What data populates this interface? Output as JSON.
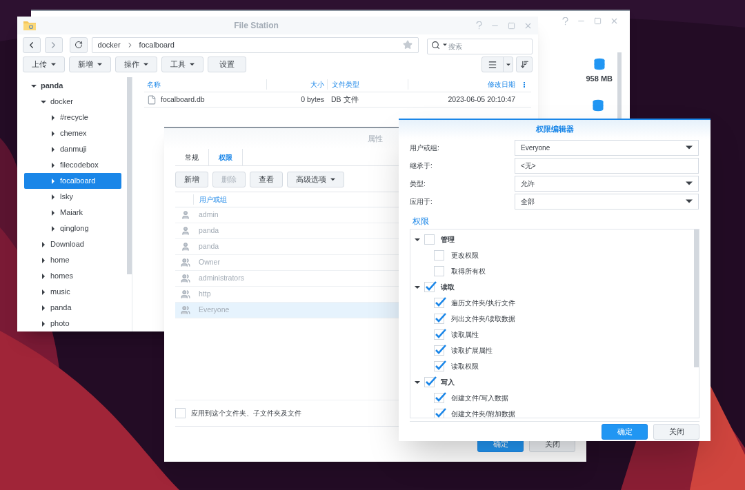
{
  "back_window": {
    "sizes": [
      "958 MB"
    ]
  },
  "file_station": {
    "title": "File Station",
    "path": [
      "docker",
      "focalboard"
    ],
    "search": {
      "placeholder": "搜索"
    },
    "toolbar": [
      {
        "label": "上传",
        "dropdown": true
      },
      {
        "label": "新增",
        "dropdown": true
      },
      {
        "label": "操作",
        "dropdown": true
      },
      {
        "label": "工具",
        "dropdown": true
      },
      {
        "label": "设置",
        "dropdown": false
      }
    ],
    "tree": [
      {
        "label": "panda",
        "expanded": true,
        "selected": false,
        "children": [
          {
            "label": "docker",
            "expanded": true,
            "selected": false,
            "children": [
              {
                "label": "#recycle",
                "expanded": false,
                "selected": false
              },
              {
                "label": "chemex",
                "expanded": false,
                "selected": false
              },
              {
                "label": "danmuji",
                "expanded": false,
                "selected": false
              },
              {
                "label": "filecodebox",
                "expanded": false,
                "selected": false
              },
              {
                "label": "focalboard",
                "expanded": false,
                "selected": true
              },
              {
                "label": "lsky",
                "expanded": false,
                "selected": false
              },
              {
                "label": "Maiark",
                "expanded": false,
                "selected": false
              },
              {
                "label": "qinglong",
                "expanded": false,
                "selected": false
              }
            ]
          },
          {
            "label": "Download",
            "expanded": false,
            "selected": false
          },
          {
            "label": "home",
            "expanded": false,
            "selected": false
          },
          {
            "label": "homes",
            "expanded": false,
            "selected": false
          },
          {
            "label": "music",
            "expanded": false,
            "selected": false
          },
          {
            "label": "panda",
            "expanded": false,
            "selected": false
          },
          {
            "label": "photo",
            "expanded": false,
            "selected": false
          }
        ]
      }
    ],
    "columns": [
      "名称",
      "大小",
      "文件类型",
      "修改日期"
    ],
    "rows": [
      {
        "name": "focalboard.db",
        "size": "0 bytes",
        "type": "DB 文件",
        "modified": "2023-06-05 20:10:47"
      }
    ]
  },
  "properties": {
    "title": "属性",
    "tabs": [
      {
        "label": "常规",
        "selected": false
      },
      {
        "label": "权限",
        "selected": true
      }
    ],
    "buttons": [
      {
        "label": "新增",
        "disabled": false,
        "dropdown": false
      },
      {
        "label": "删除",
        "disabled": true,
        "dropdown": false
      },
      {
        "label": "查看",
        "disabled": false,
        "dropdown": false
      },
      {
        "label": "高级选项",
        "disabled": false,
        "dropdown": true
      }
    ],
    "column": "用户或组",
    "entries": [
      {
        "name": "admin",
        "kind": "user",
        "selected": false
      },
      {
        "name": "panda",
        "kind": "user",
        "selected": false
      },
      {
        "name": "panda",
        "kind": "user",
        "selected": false
      },
      {
        "name": "Owner",
        "kind": "group",
        "selected": false
      },
      {
        "name": "administrators",
        "kind": "group",
        "selected": false
      },
      {
        "name": "http",
        "kind": "group",
        "selected": false
      },
      {
        "name": "Everyone",
        "kind": "group",
        "selected": true
      }
    ],
    "apply_all": {
      "label": "应用到这个文件夹、子文件夹及文件",
      "checked": false
    },
    "ok": "确定",
    "close": "关闭"
  },
  "permission_editor": {
    "title": "权限编辑器",
    "fields": [
      {
        "label": "用户或组:",
        "value": "Everyone",
        "kind": "select"
      },
      {
        "label": "继承于:",
        "value": "<无>",
        "kind": "text"
      },
      {
        "label": "类型:",
        "value": "允许",
        "kind": "select"
      },
      {
        "label": "应用于:",
        "value": "全部",
        "kind": "select"
      }
    ],
    "section": "权限",
    "permissions": [
      {
        "label": "管理",
        "checked": false,
        "expanded": true,
        "children": [
          {
            "label": "更改权限",
            "checked": false
          },
          {
            "label": "取得所有权",
            "checked": false
          }
        ]
      },
      {
        "label": "读取",
        "checked": true,
        "expanded": true,
        "children": [
          {
            "label": "遍历文件夹/执行文件",
            "checked": true
          },
          {
            "label": "列出文件夹/读取数据",
            "checked": true
          },
          {
            "label": "读取属性",
            "checked": true
          },
          {
            "label": "读取扩展属性",
            "checked": true
          },
          {
            "label": "读取权限",
            "checked": true
          }
        ]
      },
      {
        "label": "写入",
        "checked": true,
        "expanded": true,
        "children": [
          {
            "label": "创建文件/写入数据",
            "checked": true
          },
          {
            "label": "创建文件夹/附加数据",
            "checked": true
          }
        ]
      }
    ],
    "ok": "确定",
    "close": "关闭"
  }
}
